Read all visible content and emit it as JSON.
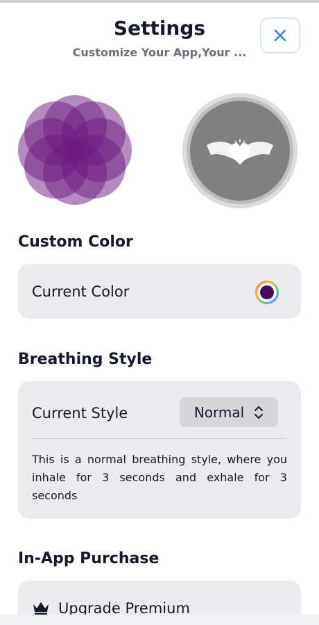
{
  "header": {
    "title": "Settings",
    "subtitle": "Customize Your App,Your ...",
    "close_icon": "close-icon"
  },
  "preview": {
    "flower_color": "#6b1a7f",
    "medal_color": "#808080",
    "medal_icon": "winged-heart-icon"
  },
  "custom_color": {
    "section_title": "Custom Color",
    "label": "Current Color",
    "value_color": "#4a0a5c"
  },
  "breathing_style": {
    "section_title": "Breathing Style",
    "label": "Current Style",
    "selected": "Normal",
    "description": "This is a normal breathing style, where you inhale for 3 seconds and exhale for 3 seconds"
  },
  "purchase": {
    "section_title": "In-App Purchase",
    "item_label": "Upgrade Premium",
    "item_icon": "crown-icon"
  }
}
